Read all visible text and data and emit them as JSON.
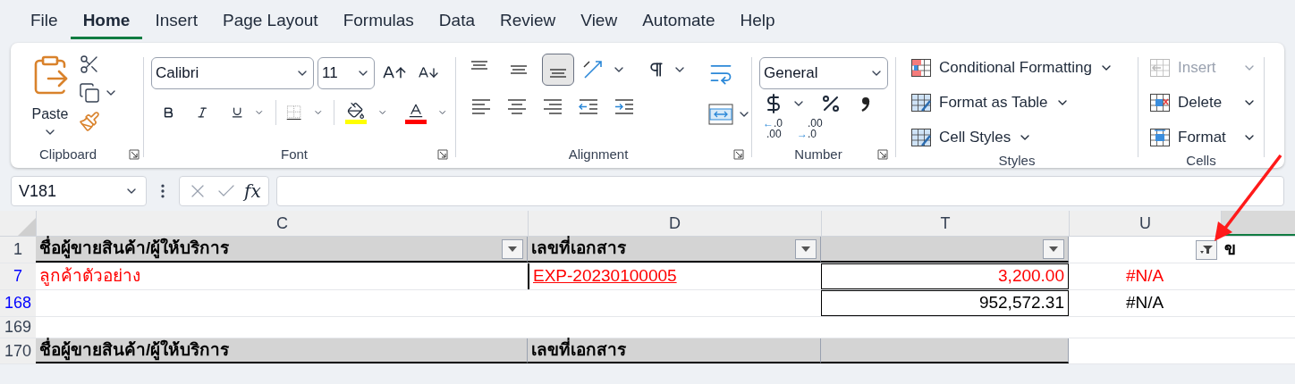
{
  "tabs": [
    {
      "label": "File",
      "selected": false
    },
    {
      "label": "Home",
      "selected": true
    },
    {
      "label": "Insert",
      "selected": false
    },
    {
      "label": "Page Layout",
      "selected": false
    },
    {
      "label": "Formulas",
      "selected": false
    },
    {
      "label": "Data",
      "selected": false
    },
    {
      "label": "Review",
      "selected": false
    },
    {
      "label": "View",
      "selected": false
    },
    {
      "label": "Automate",
      "selected": false
    },
    {
      "label": "Help",
      "selected": false
    }
  ],
  "ribbon": {
    "clipboard": {
      "paste_label": "Paste",
      "group_label": "Clipboard"
    },
    "font": {
      "font_name": "Calibri",
      "font_size": "11",
      "group_label": "Font"
    },
    "alignment": {
      "vertical": [
        {
          "kind": "top",
          "selected": false
        },
        {
          "kind": "middle",
          "selected": false
        },
        {
          "kind": "bottom",
          "selected": true
        }
      ],
      "group_label": "Alignment"
    },
    "number": {
      "format": "General",
      "decimals": [
        {
          "kind": "increase",
          "arrow": "←",
          "top": ".0",
          "bottom": ".00"
        },
        {
          "kind": "decrease",
          "arrow": "→",
          "top": ".00",
          "bottom": ".0"
        }
      ],
      "group_label": "Number"
    },
    "styles": {
      "items": [
        {
          "kind": "conditional",
          "label": "Conditional Formatting"
        },
        {
          "kind": "table",
          "label": "Format as Table"
        },
        {
          "kind": "cell",
          "label": "Cell Styles"
        }
      ],
      "group_label": "Styles"
    },
    "cells": {
      "items": [
        {
          "kind": "insert",
          "label": "Insert",
          "disabled": true
        },
        {
          "kind": "delete",
          "label": "Delete",
          "disabled": false
        },
        {
          "kind": "format",
          "label": "Format",
          "disabled": false
        }
      ],
      "group_label": "Cells"
    }
  },
  "formula_bar": {
    "name_box": "V181",
    "function_label": "fx"
  },
  "sheet": {
    "columns": [
      {
        "label": "C"
      },
      {
        "label": "D"
      },
      {
        "label": "T"
      },
      {
        "label": "U"
      }
    ],
    "rows": [
      {
        "number": "1",
        "filtered": false,
        "kind": "header",
        "cells": [
          {
            "text": "ชื่อผู้ขายสินค้า/ผู้ให้บริการ",
            "filter_button": true,
            "filter_active": false
          },
          {
            "text": "เลขที่เอกสาร",
            "filter_button": true,
            "filter_active": false
          },
          {
            "filter_button": true,
            "filter_active": false
          },
          {
            "filter_button": true,
            "filter_active": true
          },
          {
            "text": "ข"
          }
        ]
      },
      {
        "number": "7",
        "filtered": true,
        "kind": "data",
        "cells": [
          {
            "text": "ลูกค้าตัวอย่าง",
            "color": "#ff0000"
          },
          {
            "text": "EXP-20230100005",
            "color": "#ff0000",
            "link": true
          },
          {
            "text": "3,200.00",
            "color": "#ff0000",
            "error_flag": true
          },
          {
            "text": "#N/A",
            "color": "#ff0000"
          },
          {}
        ]
      },
      {
        "number": "168",
        "filtered": true,
        "kind": "data",
        "cells": [
          {},
          {},
          {
            "text": "952,572.31",
            "color": "#000000",
            "error_flag": true
          },
          {
            "text": "#N/A",
            "color": "#000000"
          },
          {}
        ]
      },
      {
        "number": "169",
        "filtered": false,
        "kind": "empty",
        "cells": [
          {},
          {},
          {},
          {},
          {}
        ]
      },
      {
        "number": "170",
        "filtered": false,
        "kind": "header",
        "cells": [
          {
            "text": "ชื่อผู้ขายสินค้า/ผู้ให้บริการ"
          },
          {
            "text": "เลขที่เอกสาร"
          },
          {},
          {},
          {}
        ]
      }
    ]
  }
}
